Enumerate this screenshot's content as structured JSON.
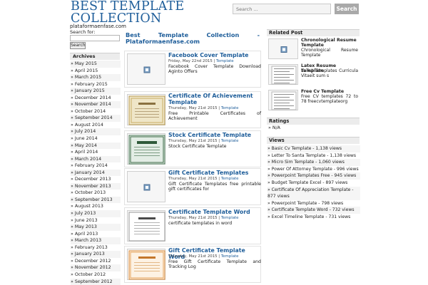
{
  "header": {
    "site_title": "BEST TEMPLATE COLLECTION",
    "site_subtitle": "plataformaenfase.com",
    "search_placeholder": "Search ...",
    "search_button": "Search"
  },
  "left_sidebar": {
    "search_label": "Search for:",
    "search_button": "Search",
    "archives_heading": "Archives",
    "archives": [
      "» May 2015",
      "» April 2015",
      "» March 2015",
      "» February 2015",
      "» January 2015",
      "» December 2014",
      "» November 2014",
      "» October 2014",
      "» September 2014",
      "» August 2014",
      "» July 2014",
      "» June 2014",
      "» May 2014",
      "» April 2014",
      "» March 2014",
      "» February 2014",
      "» January 2014",
      "» December 2013",
      "» November 2013",
      "» October 2013",
      "» September 2013",
      "» August 2013",
      "» July 2013",
      "» June 2013",
      "» May 2013",
      "» April 2013",
      "» March 2013",
      "» February 2013",
      "» January 2013",
      "» December 2012",
      "» November 2012",
      "» October 2012",
      "» September 2012"
    ]
  },
  "main": {
    "title_line1": "Best Template Collection -",
    "title_line2": "Plataformaenfase.com",
    "posts": [
      {
        "title": "Facebook Cover Template",
        "date": "Friday, May 22nd 2015",
        "sep": " | ",
        "category": "Template",
        "excerpt": "Facebook Cover Template Download Aginto Offers",
        "thumb": "placeholder"
      },
      {
        "title": "Certificate Of Achievement Template",
        "date": "Thursday, May 21st 2015",
        "sep": " | ",
        "category": "Template",
        "excerpt": "Free Printable Certificates of Achievement",
        "thumb": "gold-certificate"
      },
      {
        "title": "Stock Certificate Template",
        "date": "Thursday, May 21st 2015",
        "sep": " | ",
        "category": "Template",
        "excerpt": "Stock Certificate Template",
        "thumb": "green-certificate"
      },
      {
        "title": "Gift Certificate Templates",
        "date": "Thursday, May 21st 2015",
        "sep": " | ",
        "category": "Template",
        "excerpt": "Gift Certificate Templates free printable gift certificates for",
        "thumb": "placeholder"
      },
      {
        "title": "Certificate Template Word",
        "date": "Thursday, May 21st 2015",
        "sep": " | ",
        "category": "Template",
        "excerpt": "certificate templates in word",
        "thumb": "word-certificate"
      },
      {
        "title": "Gift Certificate Template Word",
        "date": "Thursday, May 21st 2015",
        "sep": " | ",
        "category": "Template",
        "excerpt": "Free Gift Certificate Template and Tracking Log",
        "thumb": "orange-certificate"
      }
    ]
  },
  "right_sidebar": {
    "related_heading": "Related Post",
    "related": [
      {
        "title": "Chronological Resume Template",
        "desc": "Chronological Resume Template",
        "thumb": "placeholder"
      },
      {
        "title": "Latex Resume Template",
        "desc": "LaTeX Templates Curricula Vitaeit sum s",
        "thumb": "document"
      },
      {
        "title": "Free Cv Template",
        "desc": "Free CV templates 72 to 78 freecvtemplateorg",
        "thumb": "document"
      }
    ],
    "ratings_heading": "Ratings",
    "ratings_item": "» N/A",
    "views_heading": "Views",
    "views": [
      "» Basic Cv Template - 1,138 views",
      "» Letter To Santa Template - 1,138 views",
      "» Micro Sim Template - 1,060 views",
      "» Power Of Attorney Template - 996 views",
      "» Powerpoint Templates Free - 945 views",
      "» Budget Template Excel - 897 views",
      "» Certificate Of Appreciation Template - 877 views",
      "» Powerpoint Template - 798 views",
      "» Certificate Template Word - 732 views",
      "» Excel Timeline Template - 731 views"
    ]
  },
  "colors": {
    "link": "#1f5e9a",
    "button": "#a9a9a9",
    "sidebar_head": "#ececec"
  }
}
